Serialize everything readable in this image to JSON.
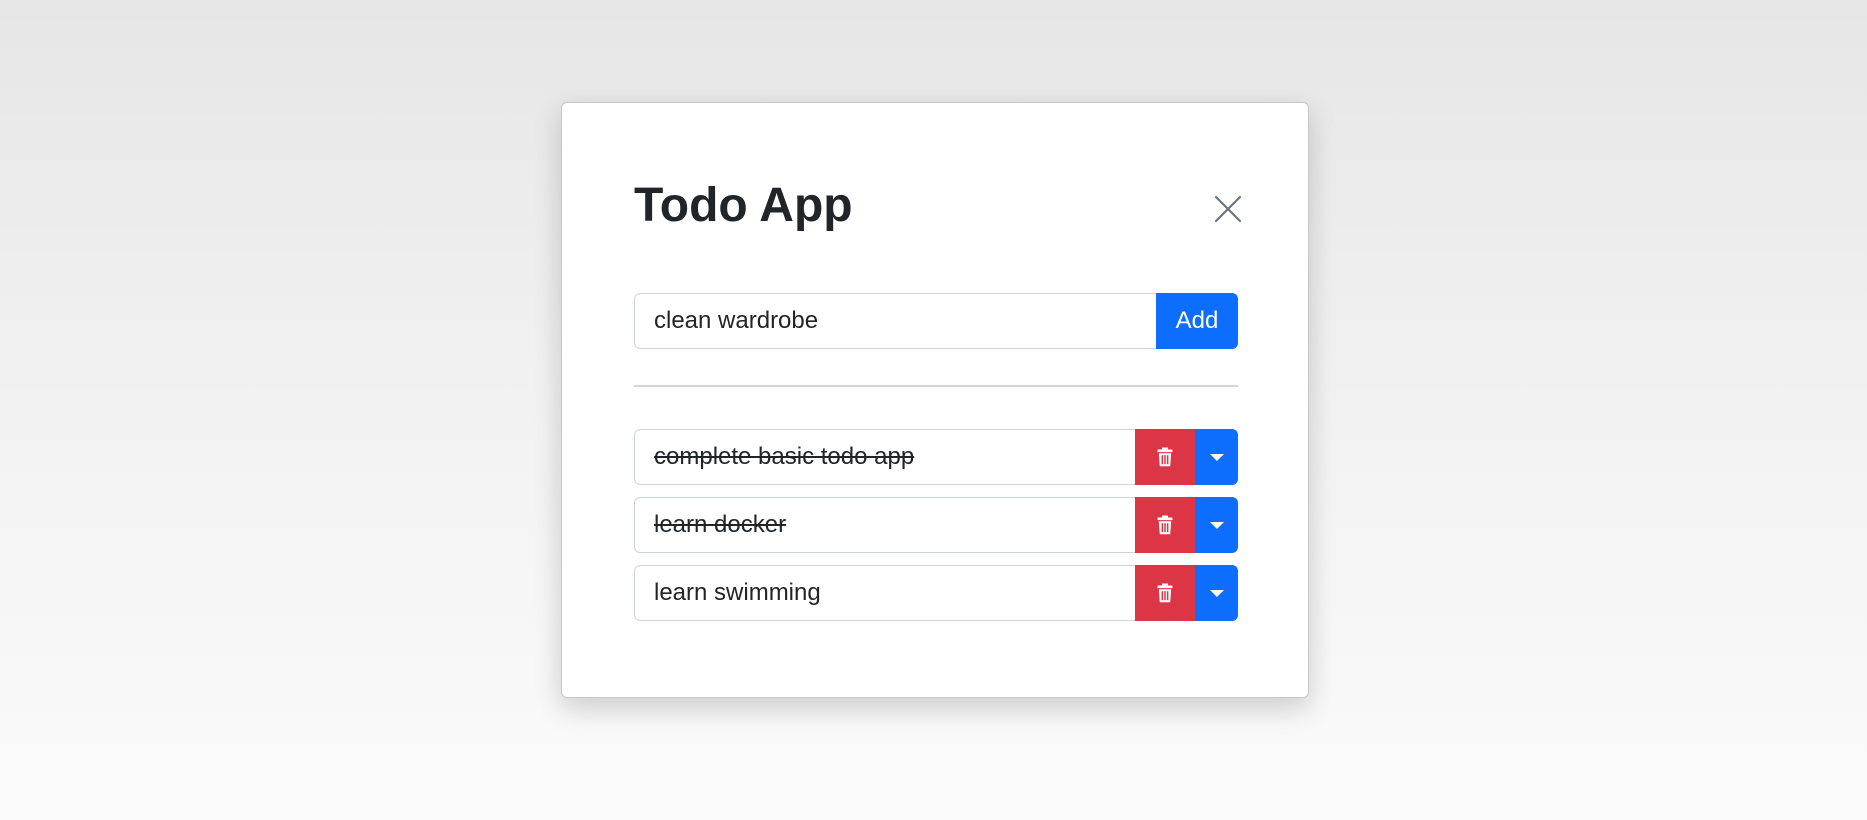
{
  "app": {
    "title": "Todo App"
  },
  "add_form": {
    "input_value": "clean wardrobe",
    "add_label": "Add"
  },
  "todos": [
    {
      "text": "complete basic todo app",
      "completed": true
    },
    {
      "text": "learn docker",
      "completed": true
    },
    {
      "text": "learn swimming",
      "completed": false
    }
  ],
  "icons": {
    "close": "close-icon",
    "delete": "trash-icon",
    "menu": "caret-down-icon"
  },
  "colors": {
    "primary": "#0d6efd",
    "danger": "#dc3545",
    "text": "#212529"
  }
}
